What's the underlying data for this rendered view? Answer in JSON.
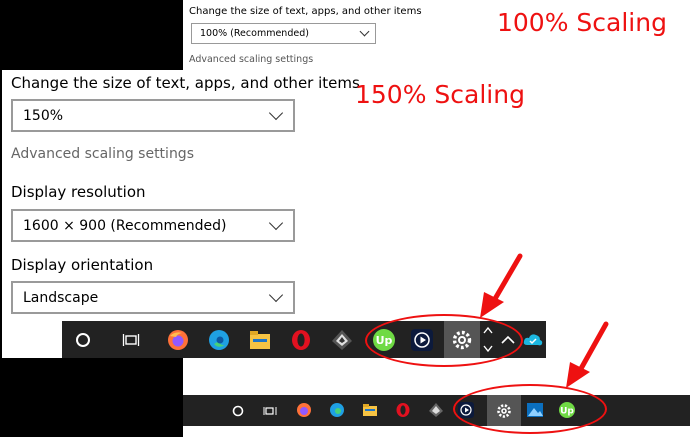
{
  "scaling_100": {
    "heading": "100% Scaling",
    "size_label": "Change the size of text, apps, and other items",
    "size_value": "100% (Recommended)",
    "advanced_link": "Advanced scaling settings"
  },
  "scaling_150": {
    "heading": "150% Scaling",
    "size_label": "Change the size of text, apps, and other items",
    "size_value": "150%",
    "advanced_link": "Advanced scaling settings",
    "resolution_label": "Display resolution",
    "resolution_value": "1600 × 900 (Recommended)",
    "orientation_label": "Display orientation",
    "orientation_value": "Landscape"
  },
  "taskbar_150": {
    "icons": [
      "cortana-icon",
      "task-view-icon",
      "firefox-icon",
      "edge-icon",
      "file-explorer-icon",
      "opera-icon",
      "network-game-icon",
      "upwork-icon",
      "media-player-icon",
      "settings-icon",
      "scroll-up-icon",
      "scroll-down-icon",
      "tray-chevron-icon",
      "cloud-app-icon"
    ]
  },
  "taskbar_100": {
    "icons": [
      "cortana-icon",
      "task-view-icon",
      "firefox-icon",
      "edge-icon",
      "file-explorer-icon",
      "opera-icon",
      "network-game-icon",
      "media-player-icon",
      "settings-icon",
      "photos-icon",
      "upwork-icon"
    ]
  },
  "colors": {
    "annotation": "#ee1111",
    "taskbar": "#222222"
  }
}
